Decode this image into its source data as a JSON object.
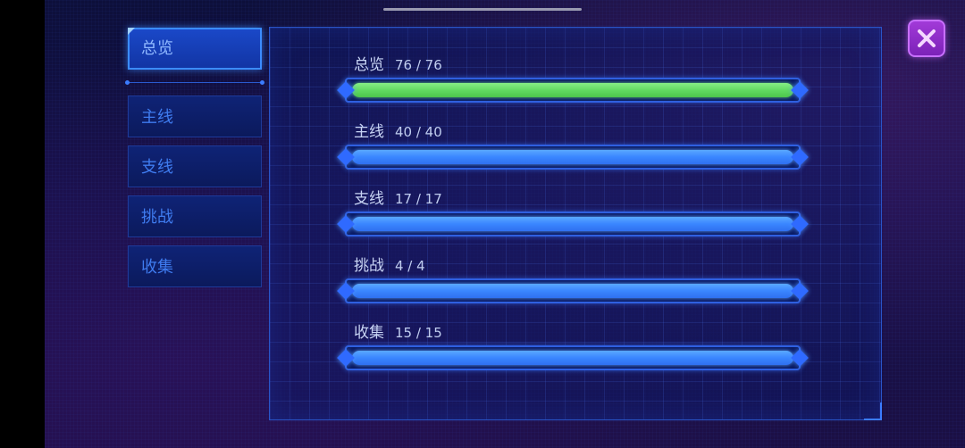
{
  "sidebar": {
    "tabs": [
      {
        "label": "总览",
        "active": true
      },
      {
        "label": "主线",
        "active": false
      },
      {
        "label": "支线",
        "active": false
      },
      {
        "label": "挑战",
        "active": false
      },
      {
        "label": "收集",
        "active": false
      }
    ]
  },
  "progress": {
    "rows": [
      {
        "label": "总览",
        "count": "76 / 76",
        "done": 76,
        "total": 76,
        "color": "#5fd85f"
      },
      {
        "label": "主线",
        "count": "40 / 40",
        "done": 40,
        "total": 40,
        "color": "#3a86ff"
      },
      {
        "label": "支线",
        "count": "17 / 17",
        "done": 17,
        "total": 17,
        "color": "#3a86ff"
      },
      {
        "label": "挑战",
        "count": "4 / 4",
        "done": 4,
        "total": 4,
        "color": "#3a86ff"
      },
      {
        "label": "收集",
        "count": "15 / 15",
        "done": 15,
        "total": 15,
        "color": "#3a86ff"
      }
    ]
  },
  "icons": {
    "close": "close-x-icon"
  },
  "colors": {
    "accent": "#3b8cff",
    "complete": "#5fd85f",
    "close_button": "#a23ad8"
  }
}
